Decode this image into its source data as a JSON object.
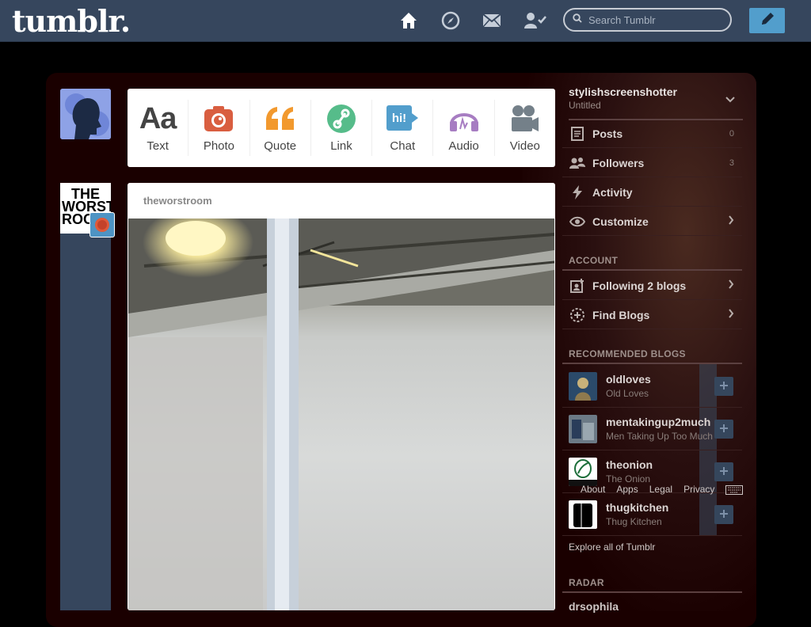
{
  "header": {
    "logo": "tumblr.",
    "search_placeholder": "Search Tumblr",
    "nav_icons": [
      "home-icon",
      "explore-icon",
      "inbox-icon",
      "account-icon"
    ]
  },
  "post_types": [
    {
      "label": "Text",
      "icon": "text-icon",
      "color": "#444444"
    },
    {
      "label": "Photo",
      "icon": "photo-icon",
      "color": "#d95e40"
    },
    {
      "label": "Quote",
      "icon": "quote-icon",
      "color": "#f2992e"
    },
    {
      "label": "Link",
      "icon": "link-icon",
      "color": "#56bc8a"
    },
    {
      "label": "Chat",
      "icon": "chat-icon",
      "color": "#529ecc"
    },
    {
      "label": "Audio",
      "icon": "audio-icon",
      "color": "#a77dc2"
    },
    {
      "label": "Video",
      "icon": "video-icon",
      "color": "#748089"
    }
  ],
  "post": {
    "blog_name": "theworstroom",
    "avatar_text": [
      "THE",
      "WORST",
      "ROO"
    ]
  },
  "sidebar": {
    "account": {
      "name": "stylishscreenshotter",
      "subtitle": "Untitled"
    },
    "menu": [
      {
        "label": "Posts",
        "count": "0",
        "icon": "posts-icon"
      },
      {
        "label": "Followers",
        "count": "3",
        "icon": "followers-icon"
      },
      {
        "label": "Activity",
        "count": "",
        "icon": "activity-icon"
      },
      {
        "label": "Customize",
        "count": "",
        "icon": "eye-icon"
      }
    ],
    "account_heading": "ACCOUNT",
    "account_menu": [
      {
        "label": "Following 2 blogs",
        "icon": "following-icon"
      },
      {
        "label": "Find Blogs",
        "icon": "find-icon"
      }
    ],
    "recommended_heading": "RECOMMENDED BLOGS",
    "recommended": [
      {
        "name": "oldloves",
        "title": "Old Loves"
      },
      {
        "name": "mentakingup2much",
        "title": "Men Taking Up Too Much"
      },
      {
        "name": "theonion",
        "title": "The Onion"
      },
      {
        "name": "thugkitchen",
        "title": "Thug Kitchen"
      }
    ],
    "footer_links": [
      "About",
      "Apps",
      "Legal",
      "Privacy"
    ],
    "explore": "Explore all of Tumblr",
    "radar_heading": "RADAR",
    "radar_peek": "drsophila"
  }
}
